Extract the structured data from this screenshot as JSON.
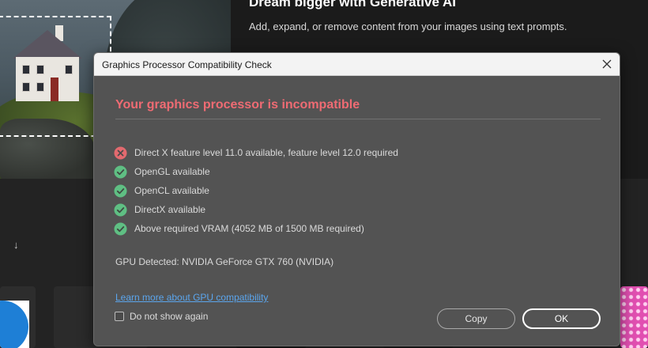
{
  "background": {
    "hero_title": "Dream bigger with Generative AI",
    "hero_subtitle": "Add, expand, or remove content from your images using text prompts.",
    "sort_arrow_glyph": "↓"
  },
  "dialog": {
    "title": "Graphics Processor Compatibility Check",
    "heading": "Your graphics processor is incompatible",
    "checks": [
      {
        "status": "fail",
        "text": "Direct X feature level 11.0 available, feature level 12.0 required"
      },
      {
        "status": "pass",
        "text": "OpenGL available"
      },
      {
        "status": "pass",
        "text": "OpenCL available"
      },
      {
        "status": "pass",
        "text": "DirectX available"
      },
      {
        "status": "pass",
        "text": "Above required VRAM (4052 MB of 1500 MB required)"
      }
    ],
    "gpu_detected": "GPU Detected: NVIDIA GeForce GTX 760 (NVIDIA)",
    "learn_more_link": "Learn more about GPU compatibility",
    "dont_show_label": "Do not show again",
    "dont_show_checked": false,
    "copy_button": "Copy",
    "ok_button": "OK"
  },
  "colors": {
    "error_heading": "#ef6b73",
    "fail_icon": "#e36a6f",
    "pass_icon": "#5fbf83",
    "link": "#5ba6ee",
    "dialog_bg": "#535353"
  },
  "icons": {
    "fail": "x-circle-icon",
    "pass": "check-circle-icon",
    "close": "close-icon"
  }
}
